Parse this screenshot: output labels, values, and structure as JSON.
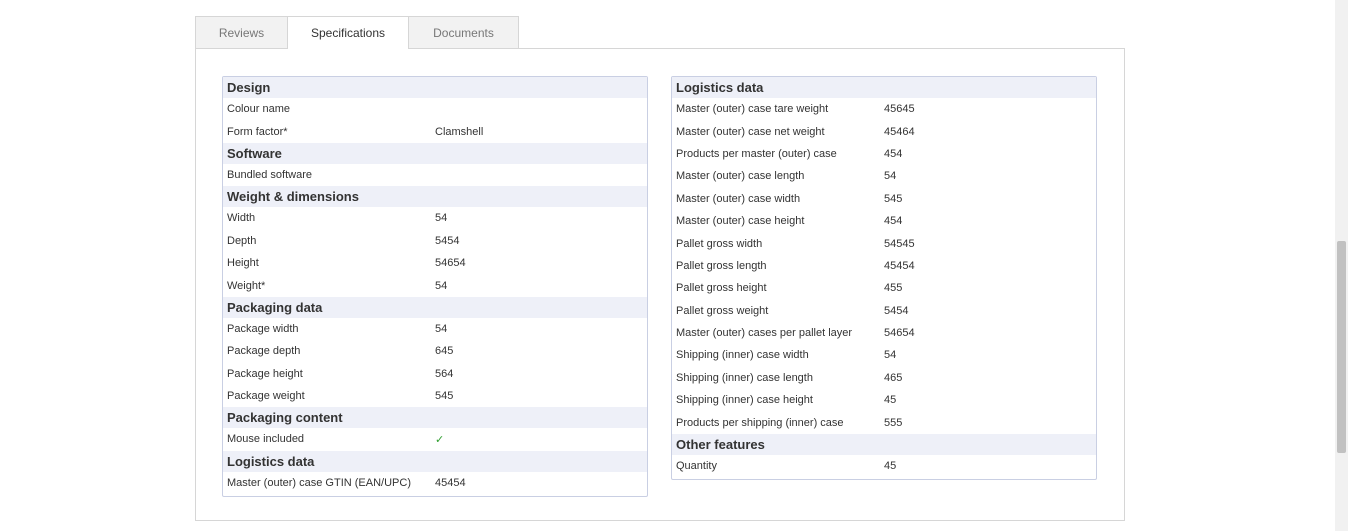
{
  "tabs": [
    {
      "label": "Reviews",
      "active": false
    },
    {
      "label": "Specifications",
      "active": true
    },
    {
      "label": "Documents",
      "active": false
    }
  ],
  "left_groups": [
    {
      "title": "Design",
      "rows": [
        {
          "label": "Colour name",
          "value": ""
        },
        {
          "label": "Form factor*",
          "value": "Clamshell"
        }
      ]
    },
    {
      "title": "Software",
      "rows": [
        {
          "label": "Bundled software",
          "value": ""
        }
      ]
    },
    {
      "title": "Weight & dimensions",
      "rows": [
        {
          "label": "Width",
          "value": "54"
        },
        {
          "label": "Depth",
          "value": "5454"
        },
        {
          "label": "Height",
          "value": "54654"
        },
        {
          "label": "Weight*",
          "value": "54"
        }
      ]
    },
    {
      "title": "Packaging data",
      "rows": [
        {
          "label": "Package width",
          "value": "54"
        },
        {
          "label": "Package depth",
          "value": "645"
        },
        {
          "label": "Package height",
          "value": "564"
        },
        {
          "label": "Package weight",
          "value": "545"
        }
      ]
    },
    {
      "title": "Packaging content",
      "rows": [
        {
          "label": "Mouse included",
          "value": "✓",
          "check": true
        }
      ]
    },
    {
      "title": "Logistics data",
      "rows": [
        {
          "label": "Master (outer) case GTIN (EAN/UPC)",
          "value": "45454"
        }
      ]
    }
  ],
  "right_groups": [
    {
      "title": "Logistics data",
      "rows": [
        {
          "label": "Master (outer) case tare weight",
          "value": "45645"
        },
        {
          "label": "Master (outer) case net weight",
          "value": "45464"
        },
        {
          "label": "Products per master (outer) case",
          "value": "454"
        },
        {
          "label": "Master (outer) case length",
          "value": "54"
        },
        {
          "label": "Master (outer) case width",
          "value": "545"
        },
        {
          "label": "Master (outer) case height",
          "value": "454"
        },
        {
          "label": "Pallet gross width",
          "value": "54545"
        },
        {
          "label": "Pallet gross length",
          "value": "45454"
        },
        {
          "label": "Pallet gross height",
          "value": "455"
        },
        {
          "label": "Pallet gross weight",
          "value": "5454"
        },
        {
          "label": "Master (outer) cases per pallet layer",
          "value": "54654"
        },
        {
          "label": "Shipping (inner) case width",
          "value": "54"
        },
        {
          "label": "Shipping (inner) case length",
          "value": "465"
        },
        {
          "label": "Shipping (inner) case height",
          "value": "45"
        },
        {
          "label": "Products per shipping (inner) case",
          "value": "555"
        }
      ]
    },
    {
      "title": "Other features",
      "rows": [
        {
          "label": "Quantity",
          "value": "45"
        }
      ]
    }
  ]
}
